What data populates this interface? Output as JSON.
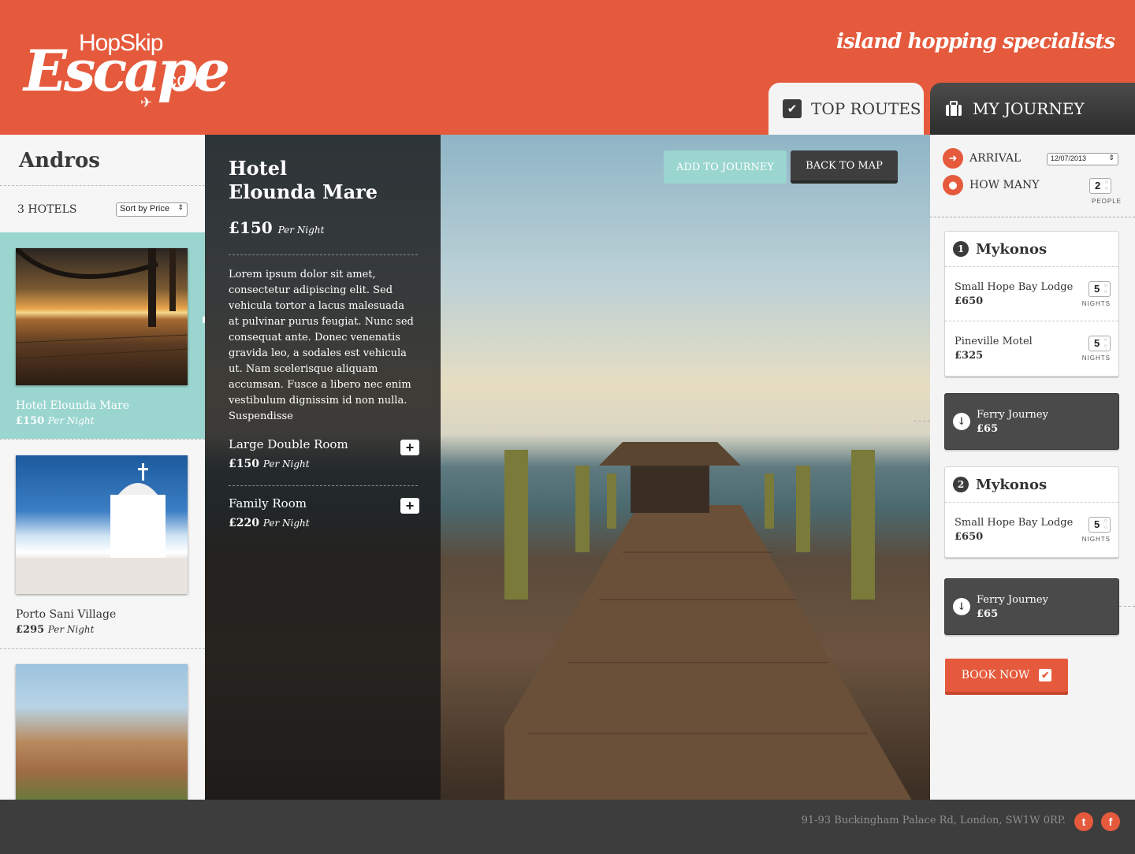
{
  "header": {
    "logo_top": "HopSkip",
    "logo_main": "Escape",
    "logo_suffix": ".com",
    "tagline": "island hopping specialists",
    "tabs": [
      {
        "label": "TOP ROUTES",
        "icon": "checkbox-icon",
        "active": true
      },
      {
        "label": "MY JOURNEY",
        "icon": "suitcase-icon",
        "active": false
      }
    ]
  },
  "sidebar": {
    "island": "Andros",
    "hotel_count": "3 HOTELS",
    "sort_value": "Sort by Price",
    "hotels": [
      {
        "name": "Hotel Elounda Mare",
        "price": "£150",
        "unit": "Per Night",
        "selected": true
      },
      {
        "name": "Porto Sani Village",
        "price": "£295",
        "unit": "Per Night",
        "selected": false
      },
      {
        "name": "",
        "price": "",
        "unit": "",
        "selected": false
      }
    ]
  },
  "detail": {
    "title_line1": "Hotel",
    "title_line2": "Elounda Mare",
    "price": "£150",
    "unit": "Per Night",
    "description": "Lorem ipsum dolor sit amet, consectetur adipiscing elit. Sed vehicula tortor a lacus malesuada at pulvinar purus feugiat. Nunc sed consequat ante. Donec venenatis gravida leo, a sodales est vehicula ut. Nam scelerisque aliquam accumsan. Fusce a libero nec enim vestibulum dignissim id non nulla. Suspendisse",
    "rooms": [
      {
        "name": "Large Double Room",
        "price": "£150",
        "unit": "Per Night"
      },
      {
        "name": "Family Room",
        "price": "£220",
        "unit": "Per Night"
      }
    ],
    "add_button": "ADD TO JOURNEY",
    "back_button": "BACK TO MAP"
  },
  "journey": {
    "arrival_label": "ARRIVAL",
    "arrival_date": "12/07/2013",
    "how_many_label": "HOW MANY",
    "people": "2",
    "people_label": "PEOPLE",
    "stops": [
      {
        "num": "1",
        "island": "Mykonos",
        "hotels": [
          {
            "name": "Small Hope Bay Lodge",
            "price": "£650",
            "nights": "5"
          },
          {
            "name": "Pineville Motel",
            "price": "£325",
            "nights": "5"
          }
        ]
      },
      {
        "num": "2",
        "island": "Mykonos",
        "hotels": [
          {
            "name": "Small Hope Bay Lodge",
            "price": "£650",
            "nights": "5"
          }
        ]
      }
    ],
    "nights_label": "NIGHTS",
    "ferries": [
      {
        "name": "Ferry Journey",
        "price": "£65"
      },
      {
        "name": "Ferry Journey",
        "price": "£65"
      }
    ],
    "book_button": "BOOK NOW"
  },
  "footer": {
    "address": "91-93 Buckingham Palace Rd, London, SW1W 0RP.",
    "social": [
      "twitter-icon",
      "facebook-icon"
    ]
  },
  "colors": {
    "brand": "#e55a3c",
    "teal": "#9ad6cf",
    "dark": "#3d3d3d"
  }
}
